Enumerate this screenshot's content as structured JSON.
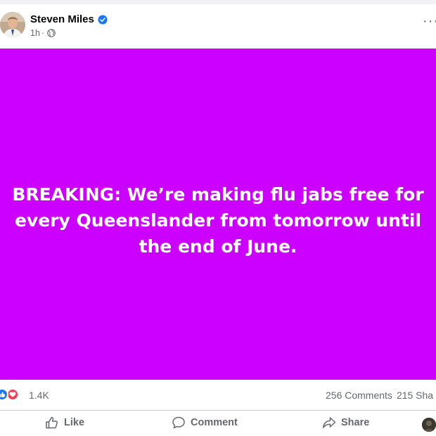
{
  "post": {
    "author_name": "Steven Miles",
    "timestamp": "1h",
    "separator": "·",
    "audience_icon": "globe-icon",
    "verified_icon": "verified-badge-icon",
    "more_icon": "ellipsis-icon",
    "more_label": "···"
  },
  "image": {
    "background_color": "#cc00ff",
    "text_line_1": "BREAKING: We’re making flu jabs free for",
    "text_line_2": "every Queenslander from tomorrow until",
    "text_line_3": "the end of June."
  },
  "stats": {
    "reaction_icons": [
      "like-reaction-icon",
      "love-reaction-icon"
    ],
    "reaction_count": "1.4K",
    "comments": "256 Comments",
    "shares": "215 Sha"
  },
  "actions": {
    "like_label": "Like",
    "comment_label": "Comment",
    "share_label": "Share"
  },
  "colors": {
    "like_blue": "#1877f2",
    "love_red": "#f33e58",
    "secondary_text": "#65676b"
  }
}
